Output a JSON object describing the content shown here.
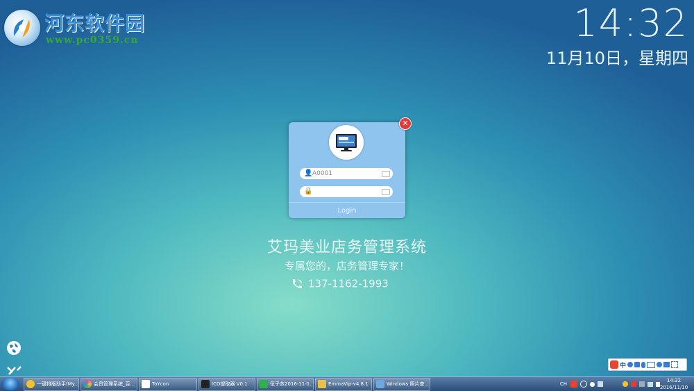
{
  "watermark": {
    "name": "河东软件园",
    "url": "www.pc0359.cn"
  },
  "clock": {
    "time": "14:32",
    "date": "11月10日，星期四"
  },
  "login": {
    "username_value": "A0001",
    "password_value": "",
    "login_label": "Login",
    "close_symbol": "✕"
  },
  "app": {
    "title": "艾玛美业店务管理系统",
    "subtitle": "专属您的，店务管理专家！",
    "phone": "137-1162-1993"
  },
  "ime": {
    "label": "中"
  },
  "taskbar": {
    "items": [
      {
        "label": "一键排版助手(My...",
        "color": "#f2c12e"
      },
      {
        "label": "会员管理系统_百...",
        "color": "#e94c8a"
      },
      {
        "label": "ToYcon",
        "color": "#ffffff"
      },
      {
        "label": "ICO提取器 V0.1",
        "color": "#222222"
      },
      {
        "label": "伍子苏2016-11-1...",
        "color": "#2db24a"
      },
      {
        "label": "EmmaVip-v4.8.1",
        "color": "#e7c04a"
      },
      {
        "label": "Windows 照片查...",
        "color": "#6aa8de"
      }
    ],
    "tray_lang": "CH",
    "time": "14:32",
    "date": "2016/11/10"
  }
}
